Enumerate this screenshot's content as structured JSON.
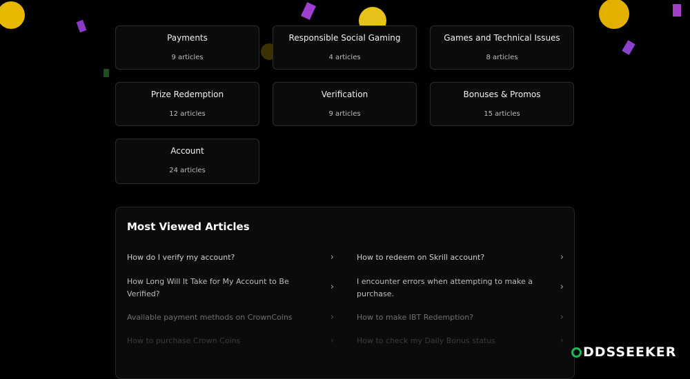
{
  "categories": [
    {
      "title": "Payments",
      "count": "9 articles"
    },
    {
      "title": "Responsible Social Gaming",
      "count": "4 articles"
    },
    {
      "title": "Games and Technical Issues",
      "count": "8 articles"
    },
    {
      "title": "Prize Redemption",
      "count": "12 articles"
    },
    {
      "title": "Verification",
      "count": "9 articles"
    },
    {
      "title": "Bonuses & Promos",
      "count": "15 articles"
    },
    {
      "title": "Account",
      "count": "24 articles"
    }
  ],
  "most_viewed": {
    "heading": "Most Viewed Articles",
    "items": [
      {
        "text": "How do I verify my account?"
      },
      {
        "text": "How to redeem on Skrill account?"
      },
      {
        "text": "How Long Will It Take for My Account to Be Verified?"
      },
      {
        "text": "I encounter errors when attempting to make a purchase."
      },
      {
        "text": "Available payment methods on CrownCoins"
      },
      {
        "text": "How to make IBT Redemption?"
      },
      {
        "text": "How to purchase Crown Coins"
      },
      {
        "text": "How to check my Daily Bonus status"
      }
    ],
    "chevron": "›"
  },
  "watermark": {
    "text": "DDSSEEKER"
  }
}
